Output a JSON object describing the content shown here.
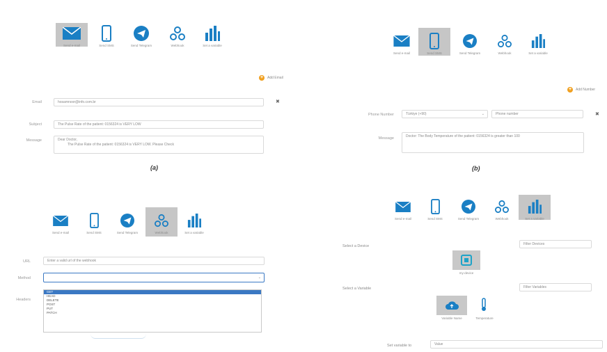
{
  "toolbar_labels": {
    "email": "Send e-mail",
    "sms": "Send SMS",
    "telegram": "Send Telegram",
    "webhook": "Webhook",
    "variable": "Set a variable"
  },
  "panel_a": {
    "add_email": "Add Email",
    "email_label": "Email",
    "email_value": "hosamnoor@info.com.br",
    "subject_label": "Subject",
    "subject_value": "The Pulse Rate of the patient: 0156324 is VERY LOW",
    "message_label": "Message",
    "message_line1": "Dear Doctor,",
    "message_line2": "The Pulse Rate of the patient: 0156324 is VERY LOW. Please Check",
    "caption": "(a)"
  },
  "panel_b": {
    "add_number": "Add Number",
    "phone_label": "Phone Number",
    "country_value": "Türkiye (+90)",
    "phone_placeholder": "Phone number",
    "message_label": "Message",
    "message_value": "Doctor: The Body Temperature of the patient: 0156324 is greater than 100",
    "caption": "(b)"
  },
  "panel_c": {
    "url_label": "URL",
    "url_placeholder": "Enter a valid url of the webhook",
    "method_label": "Method",
    "headers_label": "Headers",
    "methods": [
      "GET",
      "HEAD",
      "DELETE",
      "POST",
      "PUT",
      "PATCH"
    ],
    "selected_method": "GET"
  },
  "panel_d": {
    "select_device_label": "Select a Device",
    "device_placeholder": "Filter Devices",
    "device_name": "my-device",
    "select_variable_label": "Select a Variable",
    "variable_placeholder": "Filter Variables",
    "variable1": "Variable Name",
    "variable2": "Temperature",
    "set_value_label": "Set variable to",
    "set_value_placeholder": "Value"
  },
  "colors": {
    "icon_blue": "#1a7fc4",
    "selected_bg": "#c6c6c6",
    "add_orange": "#f0a020",
    "highlight": "#3a78c3"
  }
}
